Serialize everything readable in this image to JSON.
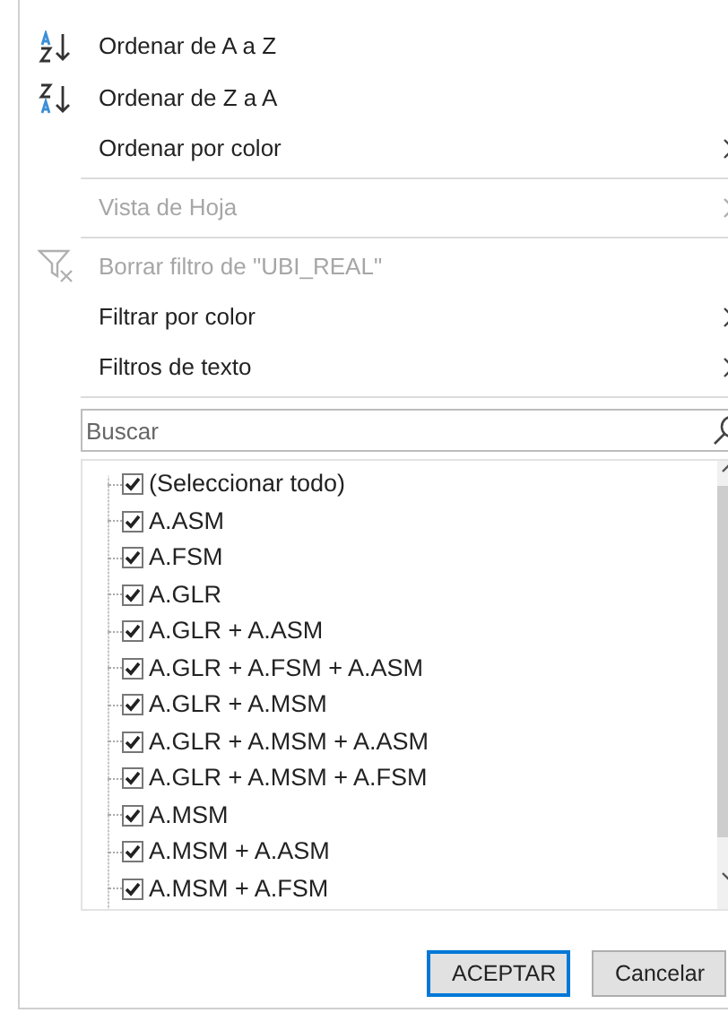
{
  "menu": [
    {
      "kind": "sort-asc",
      "label": "Ordenar de A a Z",
      "disabled": false,
      "submenu": false,
      "separator_after": false
    },
    {
      "kind": "sort-desc",
      "label": "Ordenar de Z a A",
      "disabled": false,
      "submenu": false,
      "separator_after": false
    },
    {
      "kind": "plain",
      "label": "Ordenar por color",
      "disabled": false,
      "submenu": true,
      "separator_after": true
    },
    {
      "kind": "plain",
      "label": "Vista de Hoja",
      "disabled": true,
      "submenu": true,
      "separator_after": true
    },
    {
      "kind": "clear-filter",
      "label": "Borrar filtro de \"UBI_REAL\"",
      "disabled": true,
      "submenu": false,
      "separator_after": false
    },
    {
      "kind": "plain",
      "label": "Filtrar por color",
      "disabled": false,
      "submenu": true,
      "separator_after": false
    },
    {
      "kind": "plain",
      "label": "Filtros de texto",
      "disabled": false,
      "submenu": true,
      "separator_after": true
    }
  ],
  "search": {
    "placeholder": "Buscar"
  },
  "values": [
    {
      "label": "(Seleccionar todo)",
      "checked": true
    },
    {
      "label": "A.ASM",
      "checked": true
    },
    {
      "label": "A.FSM",
      "checked": true
    },
    {
      "label": "A.GLR",
      "checked": true
    },
    {
      "label": "A.GLR + A.ASM",
      "checked": true
    },
    {
      "label": "A.GLR + A.FSM + A.ASM",
      "checked": true
    },
    {
      "label": "A.GLR + A.MSM",
      "checked": true
    },
    {
      "label": "A.GLR + A.MSM + A.ASM",
      "checked": true
    },
    {
      "label": "A.GLR + A.MSM + A.FSM",
      "checked": true
    },
    {
      "label": "A.MSM",
      "checked": true
    },
    {
      "label": "A.MSM + A.ASM",
      "checked": true
    },
    {
      "label": "A.MSM + A.FSM",
      "checked": true
    }
  ],
  "buttons": [
    {
      "label": "ACEPTAR",
      "selected": true
    },
    {
      "label": "Cancelar",
      "selected": false
    }
  ]
}
